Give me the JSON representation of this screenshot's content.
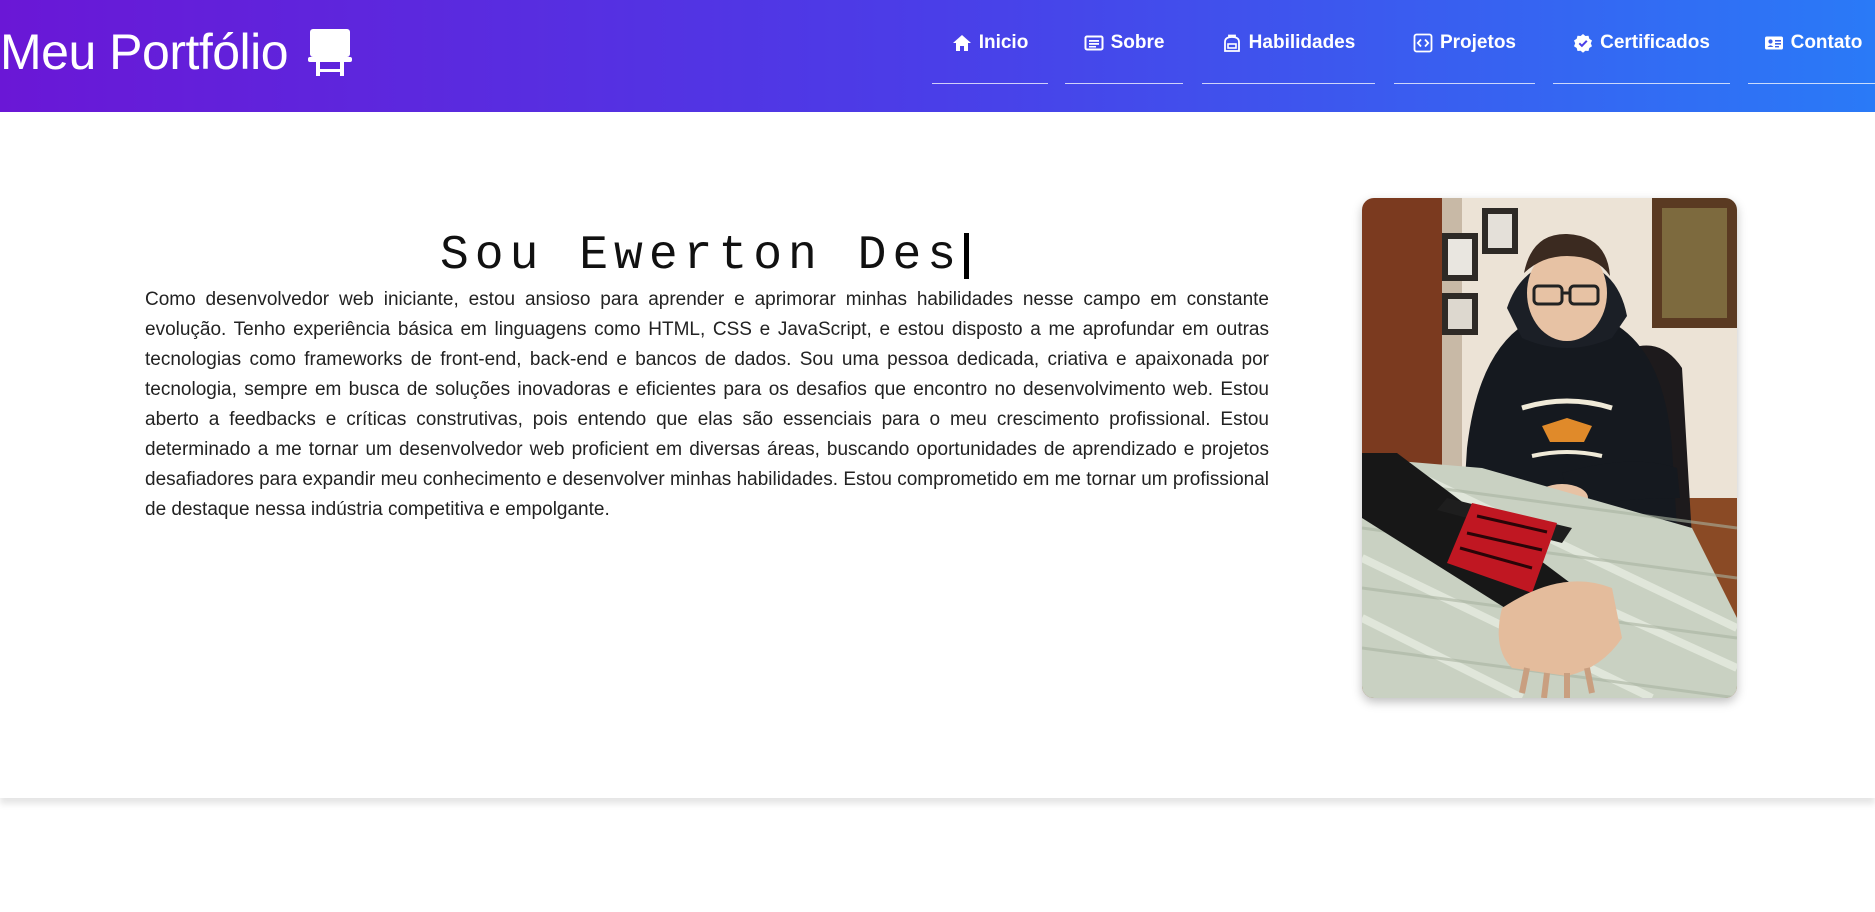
{
  "header": {
    "brand": "Meu Portfólio",
    "brand_icon": "easel-icon",
    "nav": [
      {
        "label": "Inicio",
        "icon": "home-icon"
      },
      {
        "label": "Sobre",
        "icon": "newspaper-icon"
      },
      {
        "label": "Habilidades",
        "icon": "backpack-icon"
      },
      {
        "label": "Projetos",
        "icon": "code-icon"
      },
      {
        "label": "Certificados",
        "icon": "badge-check-icon"
      },
      {
        "label": "Contato",
        "icon": "contact-card-icon"
      }
    ]
  },
  "hero": {
    "typing_text": "Sou Ewerton Des",
    "about": "Como desenvolvedor web iniciante, estou ansioso para aprender e aprimorar minhas habilidades nesse campo em constante evolução. Tenho experiência básica em linguagens como HTML, CSS e JavaScript, e estou disposto a me aprofundar em outras tecnologias como frameworks de front-end, back-end e bancos de dados. Sou uma pessoa dedicada, criativa e apaixonada por tecnologia, sempre em busca de soluções inovadoras e eficientes para os desafios que encontro no desenvolvimento web. Estou aberto a feedbacks e críticas construtivas, pois entendo que elas são essenciais para o meu crescimento profissional. Estou determinado a me tornar um desenvolvedor web proficient em diversas áreas, buscando oportunidades de aprendizado e projetos desafiadores para expandir meu conhecimento e desenvolver minhas habilidades. Estou comprometido em me tornar um profissional de destaque nessa indústria competitiva e empolgante."
  },
  "colors": {
    "gradient_start": "#6a17d6",
    "gradient_end": "#2a7af7",
    "text": "#222222"
  }
}
